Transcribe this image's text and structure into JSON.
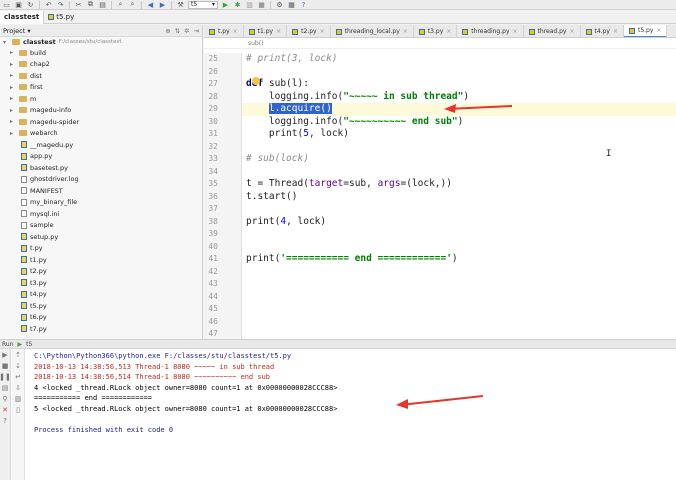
{
  "toolbar": {
    "run_config": "t5",
    "run_config_arrow": "▾"
  },
  "navbar": {
    "project_crumb": "classtest",
    "file_crumb": "t5.py"
  },
  "project_panel": {
    "title": "Project",
    "title_arrow": "▾",
    "root_name": "classtest",
    "root_path": "F:/classes/stu/classtest",
    "folders": [
      "build",
      "chap2",
      "dist",
      "first",
      "m",
      "magedu-info",
      "magedu-spider",
      "webarch"
    ],
    "files": [
      "__magedu.py",
      "app.py",
      "basetest.py",
      "ghostdriver.log",
      "MANIFEST",
      "my_binary_file",
      "mysql.ini",
      "sample",
      "setup.py",
      "t.py",
      "t1.py",
      "t2.py",
      "t3.py",
      "t4.py",
      "t5.py",
      "t6.py",
      "t7.py"
    ]
  },
  "editor": {
    "tabs": [
      "t.py",
      "t1.py",
      "t2.py",
      "threading_local.py",
      "t3.py",
      "threading.py",
      "thread.py",
      "t4.py",
      "t5.py"
    ],
    "active_tab": "t5.py",
    "breadcrumb": "sub()",
    "selected_text": "l.acquire()",
    "lines": [
      {
        "num": "25",
        "text": "# print(3, lock)",
        "kind": "comment"
      },
      {
        "num": "26",
        "text": "",
        "kind": "plain"
      },
      {
        "num": "27",
        "text": "def sub(l):",
        "kind": "def"
      },
      {
        "num": "28",
        "text": "    logging.info(\"~~~~~ in sub thread\")",
        "kind": "log"
      },
      {
        "num": "29",
        "text": "    l.acquire()",
        "kind": "selected"
      },
      {
        "num": "30",
        "text": "    logging.info(\"~~~~~~~~~~ end sub\")",
        "kind": "log"
      },
      {
        "num": "31",
        "text": "    print(5, lock)",
        "kind": "print"
      },
      {
        "num": "32",
        "text": "",
        "kind": "plain"
      },
      {
        "num": "33",
        "text": "# sub(lock)",
        "kind": "comment"
      },
      {
        "num": "34",
        "text": "",
        "kind": "plain"
      },
      {
        "num": "35",
        "text": "t = Thread(target=sub, args=(lock,))",
        "kind": "thread"
      },
      {
        "num": "36",
        "text": "t.start()",
        "kind": "plain"
      },
      {
        "num": "37",
        "text": "",
        "kind": "plain"
      },
      {
        "num": "38",
        "text": "print(4, lock)",
        "kind": "print"
      },
      {
        "num": "39",
        "text": "",
        "kind": "plain"
      },
      {
        "num": "40",
        "text": "",
        "kind": "plain"
      },
      {
        "num": "41",
        "text": "print('=========== end ============')",
        "kind": "printstr"
      },
      {
        "num": "42",
        "text": "",
        "kind": "plain"
      },
      {
        "num": "43",
        "text": "",
        "kind": "plain"
      },
      {
        "num": "44",
        "text": "",
        "kind": "plain"
      },
      {
        "num": "45",
        "text": "",
        "kind": "plain"
      },
      {
        "num": "46",
        "text": "",
        "kind": "plain"
      },
      {
        "num": "47",
        "text": "",
        "kind": "plain"
      }
    ]
  },
  "run": {
    "label": "Run",
    "config": "t5",
    "output": [
      {
        "text": "C:\\Python\\Python366\\python.exe F:/classes/stu/classtest/t5.py",
        "kind": "path"
      },
      {
        "text": "2018-10-13 14:38:56,513 Thread-1 8080 ~~~~~ in sub thread",
        "kind": "err"
      },
      {
        "text": "2018-10-13 14:38:56,514 Thread-1 8080 ~~~~~~~~~~ end sub",
        "kind": "err"
      },
      {
        "text": "4 <locked _thread.RLock object owner=8080 count=1 at 0x00000000028CCC88>",
        "kind": "out"
      },
      {
        "text": "=========== end ============",
        "kind": "out"
      },
      {
        "text": "5 <locked _thread.RLock object owner=8080 count=1 at 0x00000000028CCC88>",
        "kind": "out"
      },
      {
        "text": "",
        "kind": "out"
      },
      {
        "text": "Process finished with exit code 0",
        "kind": "fin"
      }
    ]
  },
  "colors": {
    "annotation_arrow": "#e8342b",
    "selection": "#2f65ca",
    "accent": "#4a88d6"
  }
}
